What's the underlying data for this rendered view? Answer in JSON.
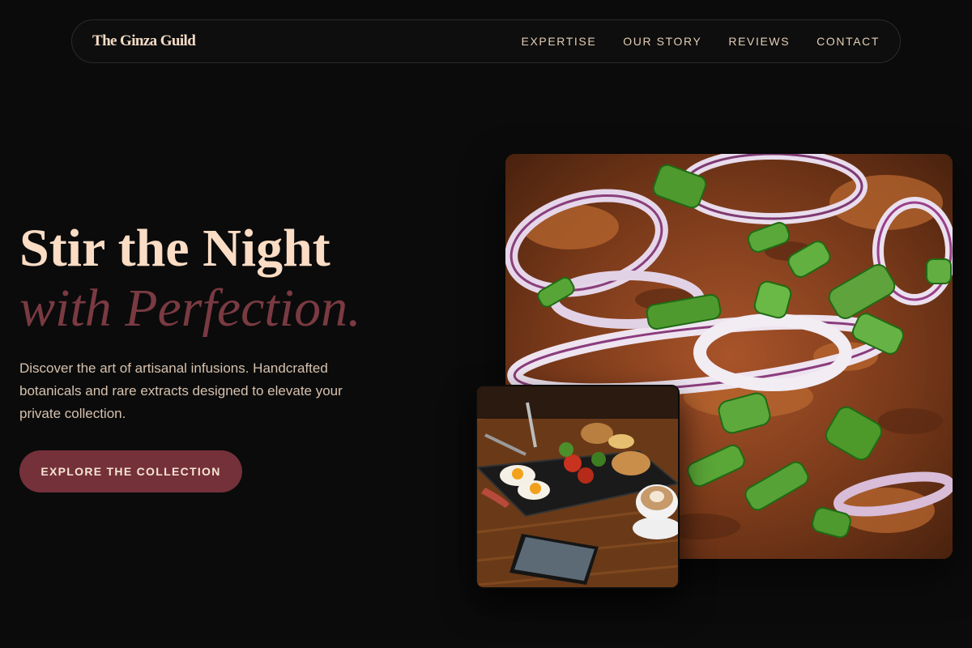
{
  "nav": {
    "brand": "The Ginza Guild",
    "links": [
      "EXPERTISE",
      "OUR STORY",
      "REVIEWS",
      "CONTACT"
    ]
  },
  "hero": {
    "title_line1": "Stir the Night",
    "title_line2": "with Perfection.",
    "description": "Discover the art of artisanal infusions. Handcrafted botanicals and rare extracts designed to elevate your private collection.",
    "cta_label": "EXPLORE THE COLLECTION"
  },
  "images": {
    "main_alt": "Close-up of shredded meat dish topped with red onion rings and green onions",
    "inset_alt": "Breakfast plate with eggs, bacon and bread beside a latte and a smartphone on a wooden table"
  },
  "colors": {
    "background": "#0b0b0b",
    "accent": "#74313a",
    "title": "#fbdcc4",
    "title_italic": "#7a3a42",
    "text": "#d6c1ae"
  }
}
